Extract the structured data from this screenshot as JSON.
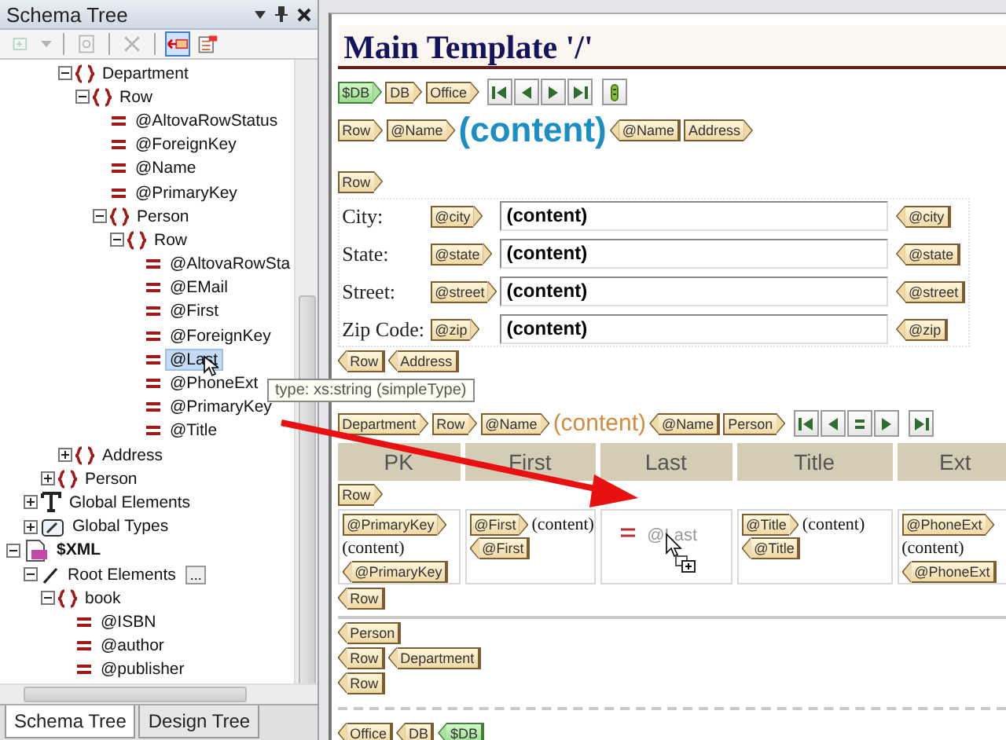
{
  "schema_panel": {
    "title": "Schema Tree",
    "toolbar": [
      {
        "kind": "add",
        "disabled": true,
        "pressed": false
      },
      {
        "kind": "dropdown",
        "disabled": true,
        "pressed": false
      },
      {
        "kind": "properties",
        "disabled": true,
        "pressed": false
      },
      {
        "kind": "delete",
        "disabled": true,
        "pressed": false
      },
      {
        "kind": "ref-left",
        "disabled": false,
        "pressed": true
      },
      {
        "kind": "ref-list",
        "disabled": false,
        "pressed": false
      }
    ],
    "tree": [
      {
        "children": [
          {
            "children": [
              {
                "children": [
                  {
                    "label": "Department",
                    "kind": "element",
                    "expanded": true,
                    "selected": false,
                    "children": [
                      {
                        "label": "Row",
                        "kind": "element",
                        "expanded": true,
                        "selected": false,
                        "children": [
                          {
                            "label": "@AltovaRowStatus",
                            "kind": "attribute",
                            "selected": false
                          },
                          {
                            "label": "@ForeignKey",
                            "kind": "attribute",
                            "selected": false
                          },
                          {
                            "label": "@Name",
                            "kind": "attribute",
                            "selected": false
                          },
                          {
                            "label": "@PrimaryKey",
                            "kind": "attribute",
                            "selected": false
                          },
                          {
                            "label": "Person",
                            "kind": "element",
                            "expanded": true,
                            "selected": false,
                            "children": [
                              {
                                "label": "Row",
                                "kind": "element",
                                "expanded": true,
                                "selected": false,
                                "children": [
                                  {
                                    "label": "@AltovaRowSta",
                                    "kind": "attribute",
                                    "selected": false
                                  },
                                  {
                                    "label": "@EMail",
                                    "kind": "attribute",
                                    "selected": false
                                  },
                                  {
                                    "label": "@First",
                                    "kind": "attribute",
                                    "selected": false
                                  },
                                  {
                                    "label": "@ForeignKey",
                                    "kind": "attribute",
                                    "selected": false
                                  },
                                  {
                                    "label": "@Last",
                                    "kind": "attribute",
                                    "selected": true
                                  },
                                  {
                                    "label": "@PhoneExt",
                                    "kind": "attribute",
                                    "selected": false
                                  },
                                  {
                                    "label": "@PrimaryKey",
                                    "kind": "attribute",
                                    "selected": false
                                  },
                                  {
                                    "label": "@Title",
                                    "kind": "attribute",
                                    "selected": false
                                  }
                                ]
                              }
                            ]
                          }
                        ]
                      }
                    ]
                  },
                  {
                    "label": "Address",
                    "kind": "element",
                    "expanded": false,
                    "selected": false
                  }
                ]
              },
              {
                "label": "Person",
                "kind": "element",
                "expanded": false,
                "selected": false
              }
            ]
          },
          {
            "label": "Global Elements",
            "kind": "global-elements",
            "expanded": false,
            "selected": false
          },
          {
            "label": "Global Types",
            "kind": "global-types",
            "expanded": false,
            "selected": false
          }
        ]
      },
      {
        "label": "$XML",
        "kind": "xml-source",
        "expanded": true,
        "selected": false,
        "children": [
          {
            "label": "Root Elements",
            "kind": "root-elements",
            "expanded": true,
            "selected": false,
            "more": "...",
            "children": [
              {
                "label": "book",
                "kind": "element",
                "expanded": true,
                "selected": false,
                "children": [
                  {
                    "label": "@ISBN",
                    "kind": "attribute",
                    "selected": false
                  },
                  {
                    "label": "@author",
                    "kind": "attribute",
                    "selected": false
                  },
                  {
                    "label": "@publisher",
                    "kind": "attribute",
                    "selected": false
                  }
                ]
              }
            ]
          }
        ]
      }
    ],
    "tooltip": "type: xs:string (simpleType)",
    "tabs": [
      {
        "label": "Schema Tree",
        "selected": true
      },
      {
        "label": "Design Tree",
        "selected": false
      }
    ]
  },
  "design": {
    "title": "Main Template '/'",
    "blocks": [
      {
        "kind": "line",
        "items": [
          {
            "kind": "source-open",
            "text": "$DB"
          },
          {
            "kind": "open",
            "text": "DB"
          },
          {
            "kind": "open",
            "text": "Office"
          },
          {
            "kind": "nav",
            "buttons": [
              {
                "kind": "first"
              },
              {
                "kind": "previous"
              },
              {
                "kind": "next"
              },
              {
                "kind": "last"
              },
              {
                "kind": "query"
              }
            ]
          }
        ]
      },
      {
        "kind": "line",
        "items": [
          {
            "kind": "open",
            "text": "Row"
          },
          {
            "kind": "open",
            "text": "@Name"
          },
          {
            "kind": "content-large",
            "text": "(content)"
          },
          {
            "kind": "close",
            "text": "@Name"
          },
          {
            "kind": "open",
            "text": "Address"
          }
        ]
      },
      {
        "kind": "line",
        "items": [
          {
            "kind": "open",
            "text": "Row"
          }
        ]
      },
      {
        "kind": "form",
        "rows": [
          {
            "label": "City:",
            "open": "@city",
            "value": "(content)",
            "close": "@city"
          },
          {
            "label": "State:",
            "open": "@state",
            "value": "(content)",
            "close": "@state"
          },
          {
            "label": "Street:",
            "open": "@street",
            "value": "(content)",
            "close": "@street"
          },
          {
            "label": "Zip Code:",
            "open": "@zip",
            "value": "(content)",
            "close": "@zip"
          }
        ]
      },
      {
        "kind": "line",
        "items": [
          {
            "kind": "close",
            "text": "Row"
          },
          {
            "kind": "close",
            "text": "Address"
          }
        ]
      },
      {
        "kind": "line",
        "items": [
          {
            "kind": "open",
            "text": "Department"
          },
          {
            "kind": "open",
            "text": "Row"
          },
          {
            "kind": "open",
            "text": "@Name"
          },
          {
            "kind": "content-accent",
            "text": "(content)"
          },
          {
            "kind": "close",
            "text": "@Name"
          },
          {
            "kind": "open",
            "text": "Person"
          },
          {
            "kind": "nav",
            "buttons": [
              {
                "kind": "first"
              },
              {
                "kind": "previous"
              },
              {
                "kind": "equal"
              },
              {
                "kind": "next"
              },
              {
                "kind": "last"
              }
            ]
          }
        ]
      },
      {
        "kind": "table",
        "columns": [
          "PK",
          "First",
          "Last",
          "Title",
          "Ext"
        ],
        "row_start": [
          {
            "kind": "open",
            "text": "Row"
          }
        ],
        "cells": [
          {
            "lines": [
              [
                {
                  "kind": "open",
                  "text": "@PrimaryKey"
                }
              ],
              [
                {
                  "kind": "content",
                  "text": "(content)"
                }
              ],
              [
                {
                  "kind": "close",
                  "text": "@PrimaryKey"
                }
              ]
            ]
          },
          {
            "lines": [
              [
                {
                  "kind": "open",
                  "text": "@First"
                },
                {
                  "kind": "content",
                  "text": "(content)"
                }
              ],
              [
                {
                  "kind": "close",
                  "text": "@First"
                }
              ]
            ]
          },
          {
            "lines": [
              [
                {
                  "kind": "attribute-drop",
                  "text": "@Last"
                }
              ]
            ]
          },
          {
            "lines": [
              [
                {
                  "kind": "open",
                  "text": "@Title"
                },
                {
                  "kind": "content",
                  "text": "(content)"
                }
              ],
              [
                {
                  "kind": "close",
                  "text": "@Title"
                }
              ]
            ]
          },
          {
            "lines": [
              [
                {
                  "kind": "open",
                  "text": "@PhoneExt"
                }
              ],
              [
                {
                  "kind": "content",
                  "text": "(content)"
                }
              ],
              [
                {
                  "kind": "close",
                  "text": "@PhoneExt"
                }
              ]
            ]
          }
        ],
        "row_end": [
          {
            "kind": "close",
            "text": "Row"
          }
        ]
      },
      {
        "kind": "divider"
      },
      {
        "kind": "line",
        "items": [
          {
            "kind": "close",
            "text": "Person"
          }
        ]
      },
      {
        "kind": "line",
        "items": [
          {
            "kind": "close",
            "text": "Row"
          },
          {
            "kind": "close",
            "text": "Department"
          }
        ]
      },
      {
        "kind": "line",
        "items": [
          {
            "kind": "close",
            "text": "Row"
          }
        ]
      },
      {
        "kind": "dashed-divider"
      },
      {
        "kind": "line",
        "items": [
          {
            "kind": "close",
            "text": "Office"
          },
          {
            "kind": "close",
            "text": "DB"
          },
          {
            "kind": "source-close",
            "text": "$DB"
          }
        ]
      }
    ]
  }
}
